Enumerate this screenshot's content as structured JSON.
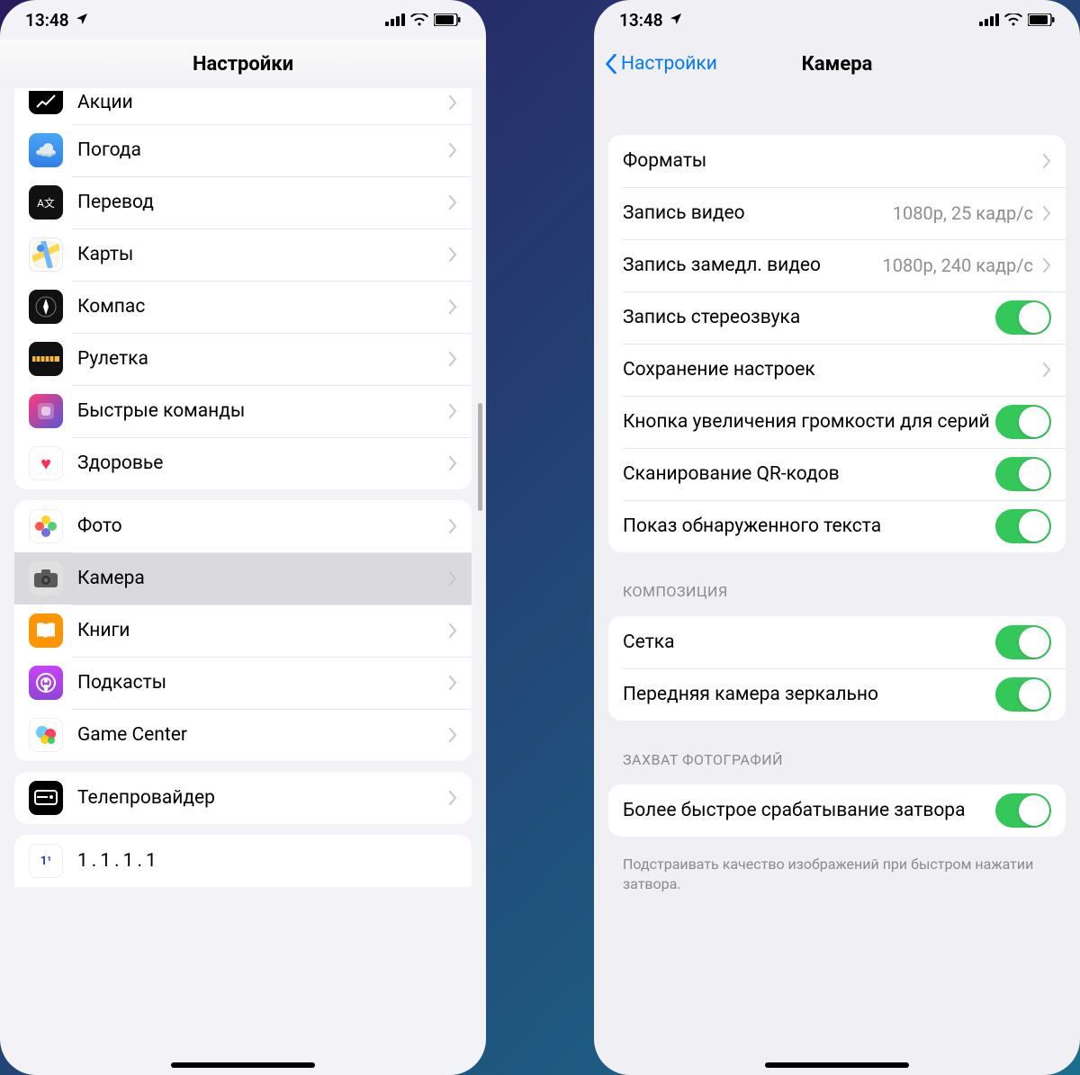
{
  "left": {
    "status": {
      "time": "13:48"
    },
    "title": "Настройки",
    "group1": [
      "Акции",
      "Погода",
      "Перевод",
      "Карты",
      "Компас",
      "Рулетка",
      "Быстрые команды",
      "Здоровье"
    ],
    "group2": [
      "Фото",
      "Камера",
      "Книги",
      "Подкасты",
      "Game Center"
    ],
    "group3": [
      "Телепровайдер"
    ],
    "group4": [
      "1.1.1.1"
    ]
  },
  "right": {
    "status": {
      "time": "13:48"
    },
    "back": "Настройки",
    "title": "Камера",
    "g1": [
      {
        "label": "Форматы"
      },
      {
        "label": "Запись видео",
        "detail": "1080p, 25 кадр/с"
      },
      {
        "label": "Запись замедл. видео",
        "detail": "1080p, 240 кадр/с"
      },
      {
        "label": "Запись стереозвука"
      },
      {
        "label": "Сохранение настроек"
      },
      {
        "label": "Кнопка увеличения громкости для серий"
      },
      {
        "label": "Сканирование QR-кодов"
      },
      {
        "label": "Показ обнаруженного текста"
      }
    ],
    "section_composition": "КОМПОЗИЦИЯ",
    "g2": [
      {
        "label": "Сетка"
      },
      {
        "label": "Передняя камера зеркально"
      }
    ],
    "section_capture": "ЗАХВАТ ФОТОГРАФИЙ",
    "g3": [
      {
        "label": "Более быстрое срабатывание затвора"
      }
    ],
    "footer_capture": "Подстраивать качество изображений при быстром нажатии затвора."
  }
}
